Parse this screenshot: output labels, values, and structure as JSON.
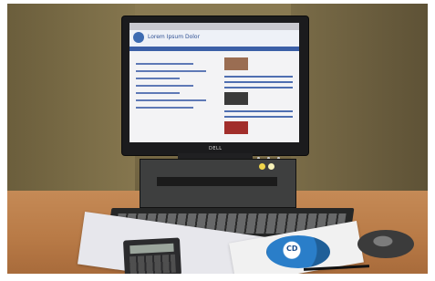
{
  "scene": {
    "monitor": {
      "brand": "DELL",
      "screen": {
        "site_title": "Lorem Ipsum Dolor"
      }
    },
    "cd_label": "CD"
  }
}
